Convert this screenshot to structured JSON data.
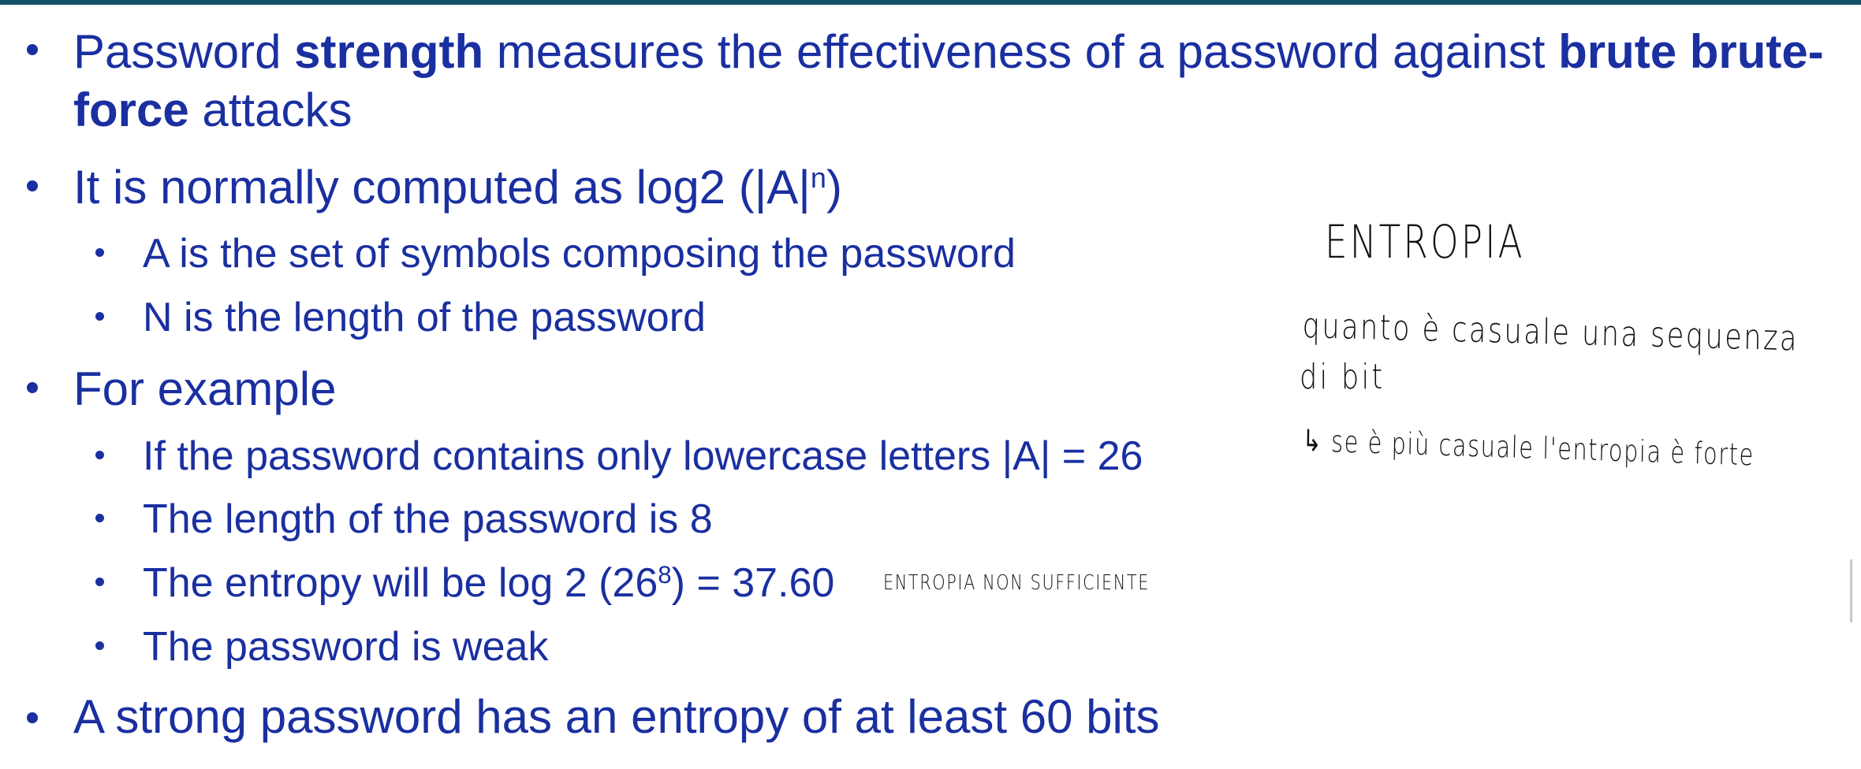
{
  "slide": {
    "bullets": [
      {
        "line1_prefix": "Password ",
        "line1_bold1": "strength",
        "line1_mid": " measures the effectiveness of a password against ",
        "line1_bold2": "brute brute-",
        "line2_bold": "force",
        "line2_suffix": " attacks"
      },
      {
        "text": "It is normally computed as log2 (|A|",
        "sup": "n",
        "suffix": ")",
        "sub": [
          {
            "text": "A is the set of symbols composing the password"
          },
          {
            "text": "N is the length of the password"
          }
        ]
      },
      {
        "text": "For example",
        "sub": [
          {
            "text": "If the password contains only lowercase letters |A| = 26"
          },
          {
            "text": "The length of the password is 8"
          },
          {
            "text": "The entropy will be log 2 (26",
            "sup": "8",
            "suffix": ") = 37.60"
          },
          {
            "text": "The password is weak"
          }
        ]
      },
      {
        "text": "A strong password has an entropy of at least 60 bits"
      }
    ]
  },
  "annotations": {
    "title": "ENTROPIA",
    "definition_line1": "quanto è casuale una sequenza",
    "definition_line2": "di bit",
    "note": "↳ se è più casuale l'entropia è forte",
    "inline_note": "ENTROPIA NON SUFFICIENTE"
  },
  "colors": {
    "text": "#1a2fa0",
    "handwriting": "#111111",
    "top_rule": "#12506a"
  }
}
